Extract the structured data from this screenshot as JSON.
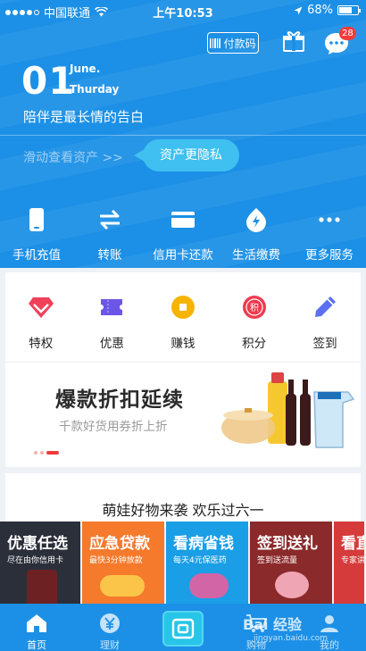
{
  "status_bar": {
    "carrier": "中国联通",
    "time": "上午10:53",
    "battery": "68%"
  },
  "header": {
    "pay_code": "付款码",
    "message_count": "28"
  },
  "date": {
    "day": "01",
    "month": "June.",
    "weekday": "Thurday"
  },
  "slogan": "陪伴是最长情的告白",
  "asset_hint": "滑动查看资产 >>",
  "privacy_button": "资产更隐私",
  "quick_actions": [
    {
      "label": "手机充值",
      "icon": "phone-icon"
    },
    {
      "label": "转账",
      "icon": "transfer-icon"
    },
    {
      "label": "信用卡还款",
      "icon": "credit-card-icon"
    },
    {
      "label": "生活缴费",
      "icon": "lightning-icon"
    },
    {
      "label": "更多服务",
      "icon": "more-icon"
    }
  ],
  "perks": [
    {
      "label": "特权",
      "icon": "diamond-icon",
      "color": "#f0415a"
    },
    {
      "label": "优惠",
      "icon": "coupon-icon",
      "color": "#6b56e8"
    },
    {
      "label": "赚钱",
      "icon": "coin-icon",
      "color": "#f6b400"
    },
    {
      "label": "积分",
      "icon": "points-icon",
      "color": "#ee3b4f",
      "mark": "积"
    },
    {
      "label": "签到",
      "icon": "pencil-icon",
      "color": "#5b6ff0"
    }
  ],
  "banner": {
    "title": "爆款折扣延续",
    "subtitle": "千款好货用券折上折"
  },
  "promo_title": "萌娃好物来袭 欢乐过六一",
  "promo_tiles": [
    {
      "title": "优惠任选",
      "subtitle": "尽在由你信用卡",
      "color": "#2b2f3a"
    },
    {
      "title": "应急贷款",
      "subtitle": "最快3分钟放款",
      "color": "#f57a2c"
    },
    {
      "title": "看病省钱",
      "subtitle": "每天4元保医药",
      "color": "#1a9ee6"
    },
    {
      "title": "签到送礼",
      "subtitle": "签到送流量",
      "color": "#8a2a2a"
    },
    {
      "title": "看直",
      "subtitle": "专家讲",
      "color": "#d63b3b"
    }
  ],
  "tabs": [
    {
      "label": "首页",
      "icon": "home-icon"
    },
    {
      "label": "理财",
      "icon": "yen-icon"
    },
    {
      "label": "",
      "icon": "scan-icon"
    },
    {
      "label": "购物",
      "icon": "cart-icon"
    },
    {
      "label": "我的",
      "icon": "user-icon"
    }
  ],
  "watermark": {
    "text": "Bai 经验",
    "url": "jingyan.baidu.com"
  }
}
